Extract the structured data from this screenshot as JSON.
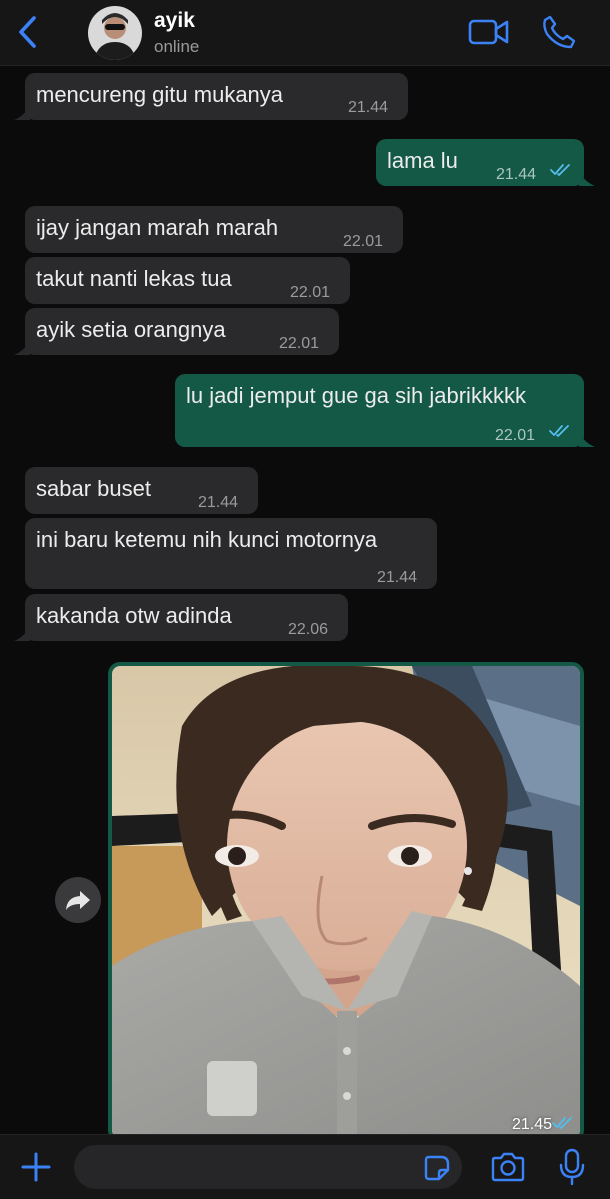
{
  "header": {
    "contact_name": "ayik",
    "status": "online",
    "icons": {
      "back": "chevron-left-icon",
      "video": "video-camera-icon",
      "call": "phone-icon"
    }
  },
  "messages": [
    {
      "dir": "in",
      "text": "mencureng gitu mukanya",
      "time": "21.44"
    },
    {
      "dir": "out",
      "text": "lama lu",
      "time": "21.44",
      "read": true
    },
    {
      "dir": "in",
      "text": "ijay jangan marah marah",
      "time": "22.01"
    },
    {
      "dir": "in",
      "text": "takut nanti lekas tua",
      "time": "22.01"
    },
    {
      "dir": "in",
      "text": "ayik setia orangnya",
      "time": "22.01"
    },
    {
      "dir": "out",
      "text": "lu jadi jemput gue ga sih jabrikkkkk",
      "time": "22.01",
      "read": true
    },
    {
      "dir": "in",
      "text": "sabar buset",
      "time": "21.44"
    },
    {
      "dir": "in",
      "text": "ini baru ketemu nih kunci motornya",
      "time": "21.44"
    },
    {
      "dir": "in",
      "text": "kakanda otw adinda",
      "time": "22.06"
    },
    {
      "dir": "out",
      "type": "photo",
      "time": "21.45",
      "read": true
    }
  ],
  "input": {
    "placeholder": ""
  },
  "colors": {
    "incoming_bubble": "#2a2a2c",
    "outgoing_bubble": "#145846",
    "accent": "#3b82f6",
    "read_tick": "#53bdeb"
  }
}
